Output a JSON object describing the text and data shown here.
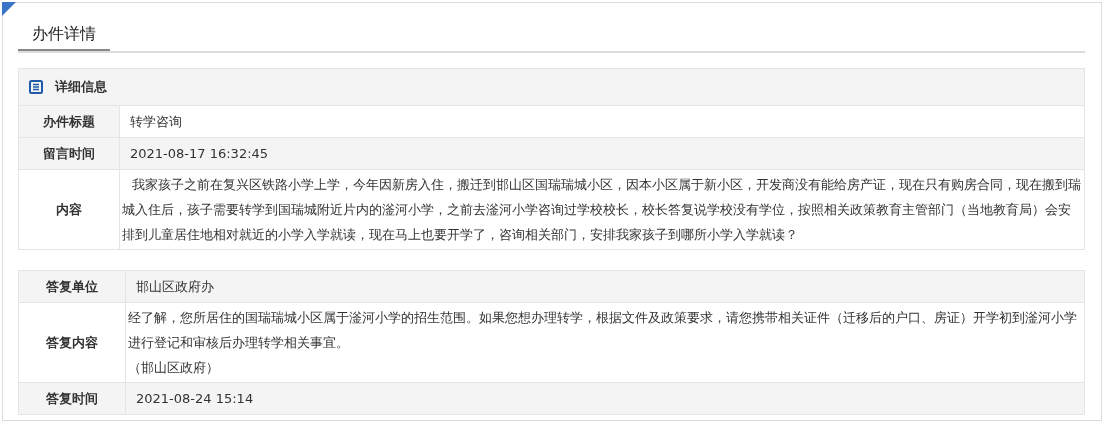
{
  "heading": "办件详情",
  "detail_section": {
    "title": "详细信息",
    "rows": [
      {
        "label": "办件标题",
        "paragraphs": [
          "转学咨询"
        ]
      },
      {
        "label": "留言时间",
        "paragraphs": [
          "2021-08-17 16:32:45"
        ]
      },
      {
        "label": "内容",
        "paragraphs": [
          "我家孩子之前在复兴区铁路小学上学，今年因新房入住，搬迁到邯山区国瑞瑞城小区，因本小区属于新小区，开发商没有能给房产证，现在只有购房合同，现在搬到瑞城入住后，孩子需要转学到国瑞城附近片内的滏河小学，之前去滏河小学咨询过学校校长，校长答复说学校没有学位，按照相关政策教育主管部门（当地教育局）会安排到儿童居住地相对就近的小学入学就读，现在马上也要开学了，咨询相关部门，安排我家孩子到哪所小学入学就读？"
        ]
      }
    ]
  },
  "reply_section": {
    "rows": [
      {
        "label": "答复单位",
        "paragraphs": [
          "邯山区政府办"
        ]
      },
      {
        "label": "答复内容",
        "paragraphs": [
          "经了解，您所居住的国瑞瑞城小区属于滏河小学的招生范围。如果您想办理转学，根据文件及政策要求，请您携带相关证件（迁移后的户口、房证）开学初到滏河小学进行登记和审核后办理转学相关事宜。",
          "（邯山区政府）"
        ]
      },
      {
        "label": "答复时间",
        "paragraphs": [
          "2021-08-24 15:14"
        ]
      }
    ]
  }
}
